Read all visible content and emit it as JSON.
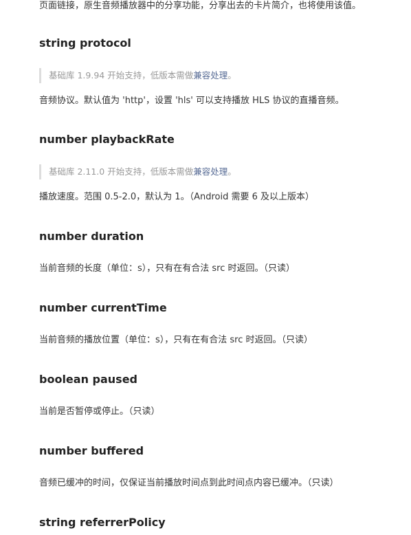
{
  "intro_tail": "页面链接，原生音频播放器中的分享功能，分享出去的卡片简介，也将使用该值。",
  "sections": [
    {
      "heading": "string protocol",
      "note_prefix": "基础库 1.9.94 开始支持，低版本需做",
      "note_link": "兼容处理",
      "note_suffix": "。",
      "description": "音频协议。默认值为 'http'，设置 'hls' 可以支持播放 HLS 协议的直播音频。"
    },
    {
      "heading": "number playbackRate",
      "note_prefix": "基础库 2.11.0 开始支持，低版本需做",
      "note_link": "兼容处理",
      "note_suffix": "。",
      "description": "播放速度。范围 0.5-2.0，默认为 1。（Android 需要 6 及以上版本）"
    },
    {
      "heading": "number duration",
      "description": "当前音频的长度（单位：s），只有在有合法 src 时返回。（只读）"
    },
    {
      "heading": "number currentTime",
      "description": "当前音频的播放位置（单位：s），只有在有合法 src 时返回。（只读）"
    },
    {
      "heading": "boolean paused",
      "description": "当前是否暂停或停止。（只读）"
    },
    {
      "heading": "number buffered",
      "description": "音频已缓冲的时间，仅保证当前播放时间点到此时间点内容已缓冲。（只读）"
    },
    {
      "heading": "string referrerPolicy"
    }
  ],
  "colors": {
    "text": "#333333",
    "heading": "#222222",
    "note_text": "#999999",
    "note_border": "#dddddd",
    "link": "#576b95"
  }
}
